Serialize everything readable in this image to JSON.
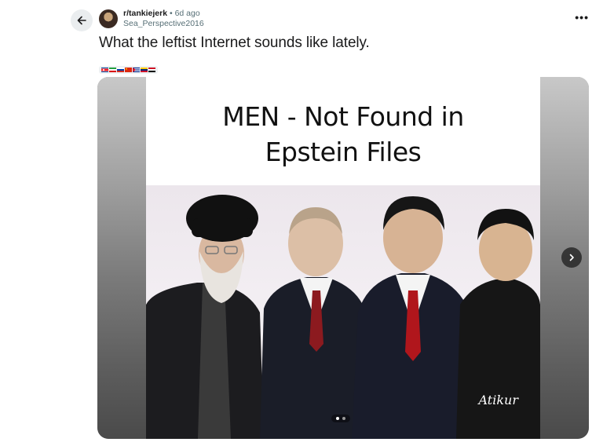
{
  "post": {
    "subreddit": "r/tankiejerk",
    "separator": "•",
    "age": "6d ago",
    "username": "Sea_Perspective2016",
    "title": "What the leftist Internet sounds like lately.",
    "more_label": "•••",
    "flair_flags": [
      "north-korea-flag",
      "iran-flag",
      "russia-flag",
      "china-flag",
      "cuba-flag",
      "venezuela-flag",
      "syria-flag"
    ]
  },
  "media": {
    "meme_line1": "MEN - Not Found in",
    "meme_line2": "Epstein Files",
    "watermark": "Atikur",
    "current_slide": 1,
    "total_slides": 2
  },
  "icons": {
    "back": "back-arrow-icon",
    "next": "chevron-right-icon"
  }
}
